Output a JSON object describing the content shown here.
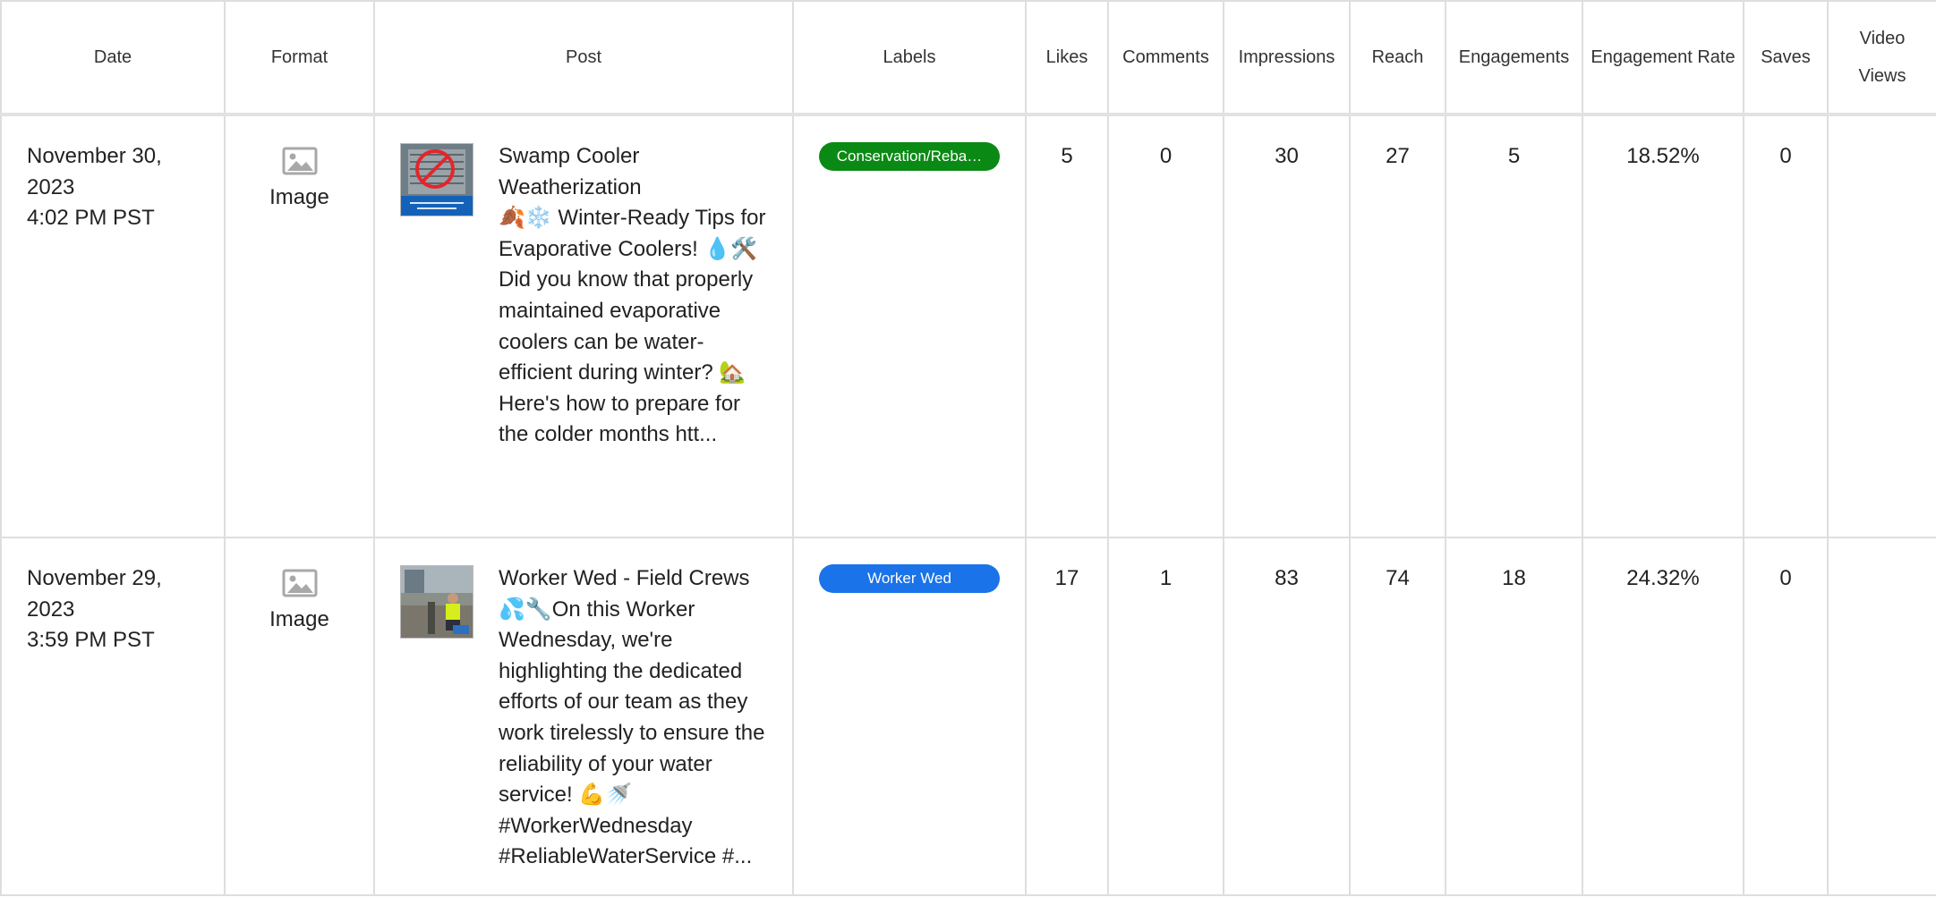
{
  "columns": {
    "date": "Date",
    "format": "Format",
    "post": "Post",
    "labels": "Labels",
    "likes": "Likes",
    "comments": "Comments",
    "impressions": "Impressions",
    "reach": "Reach",
    "engagements": "Engagements",
    "engagement_rate": "Engagement Rate",
    "saves": "Saves",
    "video_views": "Video Views"
  },
  "rows": [
    {
      "date": "November 30, 2023",
      "time": "4:02 PM PST",
      "format": "Image",
      "format_icon": "image-icon",
      "post_text": "Swamp Cooler Weatherization\n🍂❄️ Winter-Ready Tips for Evaporative Coolers! 💧🛠️\nDid you know that properly maintained evaporative coolers can be water-efficient during winter? 🏡 Here's how to prepare for the colder months htt...",
      "label": "Conservation/Reba…",
      "label_color": "#0a8a14",
      "likes": "5",
      "comments": "0",
      "impressions": "30",
      "reach": "27",
      "engagements": "5",
      "engagement_rate": "18.52%",
      "saves": "0",
      "video_views": ""
    },
    {
      "date": "November 29, 2023",
      "time": "3:59 PM PST",
      "format": "Image",
      "format_icon": "image-icon",
      "post_text": "Worker Wed - Field Crews 💦🔧On this Worker Wednesday, we're highlighting the dedicated efforts of our team as they work tirelessly to ensure the reliability of your water service! 💪🚿 #WorkerWednesday #ReliableWaterService #...",
      "label": "Worker Wed",
      "label_color": "#1a73e8",
      "likes": "17",
      "comments": "1",
      "impressions": "83",
      "reach": "74",
      "engagements": "18",
      "engagement_rate": "24.32%",
      "saves": "0",
      "video_views": ""
    }
  ]
}
